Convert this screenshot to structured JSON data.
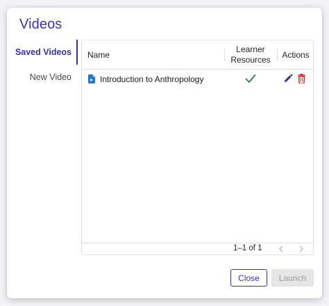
{
  "dialog": {
    "title": "Videos"
  },
  "tabs": [
    {
      "label": "Saved Videos",
      "active": true
    },
    {
      "label": "New Video",
      "active": false
    }
  ],
  "table": {
    "columns": {
      "name": "Name",
      "learner_resources": [
        "Learner",
        "Resources"
      ],
      "actions": "Actions"
    },
    "rows": [
      {
        "name": "Introduction to Anthropology",
        "type_icon": "document-icon",
        "learner_resources": true
      }
    ],
    "pagination": {
      "text": "1–1 of 1"
    }
  },
  "buttons": {
    "close": "Close",
    "launch": "Launch"
  },
  "colors": {
    "accent": "#3b2fb5",
    "file_icon": "#1976d2",
    "check": "#2e7d32",
    "delete": "#d32f2f",
    "disabled_bg": "#e6e6e6",
    "disabled_text": "#9b9b9b"
  }
}
